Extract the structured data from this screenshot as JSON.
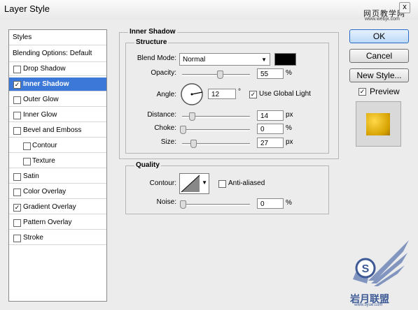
{
  "window": {
    "title": "Layer Style",
    "close_glyph": "x"
  },
  "watermark_top": {
    "line1": "网页教学网",
    "line2": "www.webjx.com"
  },
  "styles_list": [
    {
      "label": "Styles",
      "kind": "header"
    },
    {
      "label": "Blending Options: Default",
      "kind": "header"
    },
    {
      "label": "Drop Shadow",
      "checked": false
    },
    {
      "label": "Inner Shadow",
      "checked": true,
      "selected": true
    },
    {
      "label": "Outer Glow",
      "checked": false
    },
    {
      "label": "Inner Glow",
      "checked": false
    },
    {
      "label": "Bevel and Emboss",
      "checked": false
    },
    {
      "label": "Contour",
      "checked": false,
      "sub": true
    },
    {
      "label": "Texture",
      "checked": false,
      "sub": true
    },
    {
      "label": "Satin",
      "checked": false
    },
    {
      "label": "Color Overlay",
      "checked": false
    },
    {
      "label": "Gradient Overlay",
      "checked": true
    },
    {
      "label": "Pattern Overlay",
      "checked": false
    },
    {
      "label": "Stroke",
      "checked": false
    }
  ],
  "inner_shadow": {
    "section_title": "Inner Shadow",
    "structure_title": "Structure",
    "blend_mode": {
      "label": "Blend Mode:",
      "value": "Normal",
      "color": "#000000"
    },
    "opacity": {
      "label": "Opacity:",
      "value": "55",
      "unit": "%",
      "level": 0.55
    },
    "angle": {
      "label": "Angle:",
      "value": "12",
      "unit": "°",
      "global_light_label": "Use Global Light",
      "global_light_checked": true
    },
    "distance": {
      "label": "Distance:",
      "value": "14",
      "unit": "px",
      "level": 0.05
    },
    "choke": {
      "label": "Choke:",
      "value": "0",
      "unit": "%",
      "level": 0.0
    },
    "size": {
      "label": "Size:",
      "value": "27",
      "unit": "px",
      "level": 0.11
    }
  },
  "quality": {
    "title": "Quality",
    "contour_label": "Contour:",
    "anti_aliased_label": "Anti-aliased",
    "anti_aliased_checked": false,
    "noise": {
      "label": "Noise:",
      "value": "0",
      "unit": "%",
      "level": 0.0
    }
  },
  "buttons": {
    "ok": "OK",
    "cancel": "Cancel",
    "new_style": "New Style..."
  },
  "preview": {
    "label": "Preview",
    "checked": true
  },
  "watermark_bottom": {
    "text": "岩月联盟",
    "url": "www.5yue.com"
  }
}
